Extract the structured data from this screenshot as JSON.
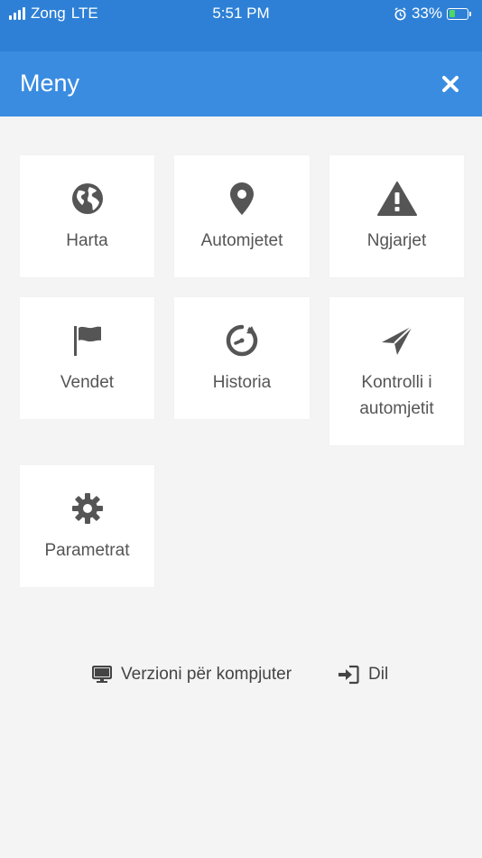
{
  "status_bar": {
    "carrier": "Zong",
    "network": "LTE",
    "time": "5:51 PM",
    "battery": "33%",
    "battery_level": 0.33
  },
  "header": {
    "title": "Meny",
    "close_icon": "close-icon"
  },
  "tiles": [
    {
      "label": "Harta",
      "icon": "globe-icon"
    },
    {
      "label": "Automjetet",
      "icon": "map-pin-icon"
    },
    {
      "label": "Ngjarjet",
      "icon": "warning-icon"
    },
    {
      "label": "Vendet",
      "icon": "flag-icon"
    },
    {
      "label": "Historia",
      "icon": "history-icon"
    },
    {
      "label": "Kontrolli i automjetit",
      "icon": "send-icon"
    },
    {
      "label": "Parametrat",
      "icon": "gear-icon"
    }
  ],
  "footer": {
    "desktop_label": "Verzioni për kompjuter",
    "logout_label": "Dil"
  },
  "colors": {
    "status_bar": "#2e80d6",
    "header": "#3a8ce0",
    "background": "#f4f4f4",
    "tile": "#ffffff",
    "icon": "#555555"
  }
}
